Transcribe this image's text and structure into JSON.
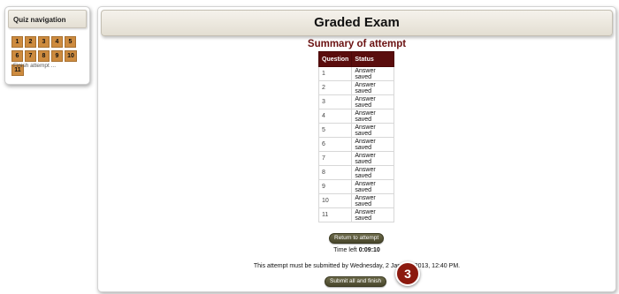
{
  "sidebar": {
    "title": "Quiz navigation",
    "question_buttons": [
      "1",
      "2",
      "3",
      "4",
      "5",
      "6",
      "7",
      "8",
      "9",
      "10",
      "11"
    ],
    "finish_link": "Finish attempt ..."
  },
  "main": {
    "page_title": "Graded Exam",
    "summary_title": "Summary of attempt",
    "table": {
      "headers": [
        "Question",
        "Status"
      ],
      "rows": [
        {
          "question": "1",
          "status": "Answer saved"
        },
        {
          "question": "2",
          "status": "Answer saved"
        },
        {
          "question": "3",
          "status": "Answer saved"
        },
        {
          "question": "4",
          "status": "Answer saved"
        },
        {
          "question": "5",
          "status": "Answer saved"
        },
        {
          "question": "6",
          "status": "Answer saved"
        },
        {
          "question": "7",
          "status": "Answer saved"
        },
        {
          "question": "8",
          "status": "Answer saved"
        },
        {
          "question": "9",
          "status": "Answer saved"
        },
        {
          "question": "10",
          "status": "Answer saved"
        },
        {
          "question": "11",
          "status": "Answer saved"
        }
      ]
    },
    "return_button": "Return to attempt",
    "time_left_label": "Time left",
    "time_left_value": "0:09:10",
    "deadline_text": "This attempt must be submitted by Wednesday, 2 January 2013, 12:40 PM.",
    "submit_button": "Submit all and finish",
    "step_badge": "3"
  },
  "colors": {
    "question_button_bg": "#cd8b3f",
    "table_header_bg": "#5a0d0d",
    "summary_title": "#6b1212",
    "button_bg": "#48462b",
    "badge_bg": "#8c1a0f"
  }
}
